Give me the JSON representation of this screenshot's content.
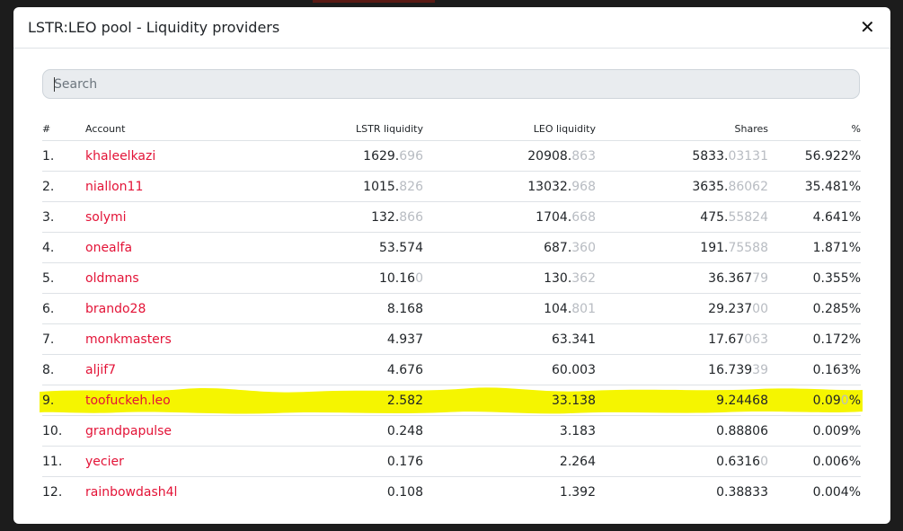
{
  "modal": {
    "title": "LSTR:LEO pool - Liquidity providers",
    "close_symbol": "✕"
  },
  "search": {
    "placeholder": "Search"
  },
  "highlight_color": "#f5f500",
  "accent_color": "#e31337",
  "table": {
    "headers": {
      "index": "#",
      "account": "Account",
      "lstr": "LSTR liquidity",
      "leo": "LEO liquidity",
      "shares": "Shares",
      "pct": "%"
    },
    "rows": [
      {
        "idx": "1.",
        "account": "khaleelkazi",
        "lstr": "1629.",
        "lstr_dim": "696",
        "leo": "20908.",
        "leo_dim": "863",
        "shares": "5833.",
        "shares_dim": "03131",
        "pct": "56.922%"
      },
      {
        "idx": "2.",
        "account": "niallon11",
        "lstr": "1015.",
        "lstr_dim": "826",
        "leo": "13032.",
        "leo_dim": "968",
        "shares": "3635.",
        "shares_dim": "86062",
        "pct": "35.481%"
      },
      {
        "idx": "3.",
        "account": "solymi",
        "lstr": "132.",
        "lstr_dim": "866",
        "leo": "1704.",
        "leo_dim": "668",
        "shares": "475.",
        "shares_dim": "55824",
        "pct": "4.641%"
      },
      {
        "idx": "4.",
        "account": "onealfa",
        "lstr": "53.574",
        "lstr_dim": "",
        "leo": "687.",
        "leo_dim": "360",
        "shares": "191.",
        "shares_dim": "75588",
        "pct": "1.871%"
      },
      {
        "idx": "5.",
        "account": "oldmans",
        "lstr": "10.16",
        "lstr_dim": "0",
        "leo": "130.",
        "leo_dim": "362",
        "shares": "36.367",
        "shares_dim": "79",
        "pct": "0.355%"
      },
      {
        "idx": "6.",
        "account": "brando28",
        "lstr": "8.168",
        "lstr_dim": "",
        "leo": "104.",
        "leo_dim": "801",
        "shares": "29.237",
        "shares_dim": "00",
        "pct": "0.285%"
      },
      {
        "idx": "7.",
        "account": "monkmasters",
        "lstr": "4.937",
        "lstr_dim": "",
        "leo": "63.341",
        "leo_dim": "",
        "shares": "17.67",
        "shares_dim": "063",
        "pct": "0.172%"
      },
      {
        "idx": "8.",
        "account": "aljif7",
        "lstr": "4.676",
        "lstr_dim": "",
        "leo": "60.003",
        "leo_dim": "",
        "shares": "16.739",
        "shares_dim": "39",
        "pct": "0.163%"
      },
      {
        "idx": "9.",
        "account": "toofuckeh.leo",
        "lstr": "2.582",
        "lstr_dim": "",
        "leo": "33.138",
        "leo_dim": "",
        "shares": "9.24468",
        "shares_dim": "",
        "pct": "0.09",
        "pct_dim": "0",
        "pct_tail": "%"
      },
      {
        "idx": "10.",
        "account": "grandpapulse",
        "lstr": "0.248",
        "lstr_dim": "",
        "leo": "3.183",
        "leo_dim": "",
        "shares": "0.88806",
        "shares_dim": "",
        "pct": "0.009%"
      },
      {
        "idx": "11.",
        "account": "yecier",
        "lstr": "0.176",
        "lstr_dim": "",
        "leo": "2.264",
        "leo_dim": "",
        "shares": "0.6316",
        "shares_dim": "0",
        "pct": "0.006%"
      },
      {
        "idx": "12.",
        "account": "rainbowdash4l",
        "lstr": "0.108",
        "lstr_dim": "",
        "leo": "1.392",
        "leo_dim": "",
        "shares": "0.38833",
        "shares_dim": "",
        "pct": "0.004%"
      }
    ]
  }
}
